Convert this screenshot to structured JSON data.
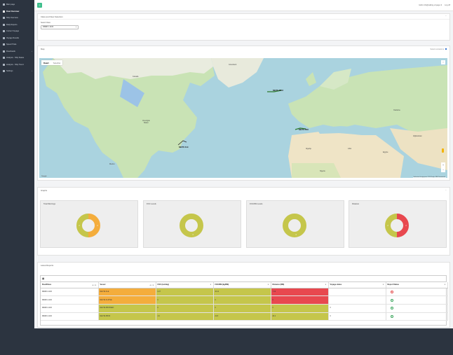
{
  "sidebar": {
    "items": [
      {
        "label": "Main page",
        "icon": "home-icon",
        "active": false
      },
      {
        "label": "Fleet Overview",
        "icon": "fleet-icon",
        "active": true
      },
      {
        "label": "Ship Overview",
        "icon": "ship-icon",
        "active": false
      },
      {
        "label": "Daily Reports",
        "icon": "report-icon",
        "active": false
      },
      {
        "label": "Current Voyage",
        "icon": "play-icon",
        "active": false
      },
      {
        "label": "Voyage Results",
        "icon": "results-icon",
        "active": false
      },
      {
        "label": "Speed Trials",
        "icon": "speed-icon",
        "active": false
      },
      {
        "label": "Downloads",
        "icon": "download-icon",
        "active": false,
        "has_children": true
      },
      {
        "label": "Analysis - Ship Status",
        "icon": "chart-icon",
        "active": false
      },
      {
        "label": "Analysis - Ship Trend",
        "icon": "trend-icon",
        "active": false
      },
      {
        "label": "Settings",
        "icon": "gear-icon",
        "active": false,
        "has_children": true
      }
    ]
  },
  "topbar": {
    "menu_icon": "hamburger-icon",
    "user": "Hello info@sailing-voyage.nl",
    "logout": "Log off"
  },
  "class_card": {
    "title": "Class and Fleet Selection",
    "select_label": "Select Class",
    "select_value": "DREB 1.1100"
  },
  "map_card": {
    "title": "Map",
    "toggle_label": "Select emissions",
    "tab_map": "Kaart",
    "tab_satellite": "Satelliet",
    "footer": "Sneltoetsen  Kaartgegevens ©2024 Google, INEGI  Voorwaarden",
    "google": "Google",
    "labels": {
      "canada": "Canada",
      "us": "Verenigde\nStaten",
      "mexico": "Mexico",
      "greenland": "Groenland",
      "algeria": "Algerije",
      "libya": "Libië",
      "egypt": "Egypte",
      "nigeria": "Nigeria",
      "afghanistan": "Afghanistan",
      "ukraine": "Oekraïne"
    },
    "vessels": [
      "NECTE CLE",
      "NECTE FRC2",
      "NECTE PRO"
    ]
  },
  "graphs_card": {
    "title": "Graphs",
    "charts": [
      {
        "title": "Total Warnings",
        "colors": [
          "#f4ad3c",
          "#c5c64b"
        ],
        "slices": [
          50,
          50
        ],
        "labels": [
          "2",
          "2"
        ]
      },
      {
        "title": "FOC Levels",
        "colors": [
          "#c5c64b"
        ],
        "slices": [
          100
        ],
        "labels": [
          "4"
        ]
      },
      {
        "title": "FOC/NM Levels",
        "colors": [
          "#c5c64b"
        ],
        "slices": [
          100
        ],
        "labels": [
          "4"
        ]
      },
      {
        "title": "Distance",
        "colors": [
          "#e8484f",
          "#c5c64b"
        ],
        "slices": [
          50,
          50
        ],
        "labels": [
          "2",
          "2"
        ]
      }
    ]
  },
  "reports_card": {
    "title": "Latest Reports",
    "tool_icon": "grid-icon",
    "columns": [
      "Fleet/Class",
      "Vessel",
      "FOC (ton/day)",
      "FOC/NM (kg/NM)",
      "Distance (NM)",
      "Voyage status",
      "Report Status"
    ],
    "rows": [
      {
        "fleet": "DREB 1.1100",
        "vessel": "NECTE CLE",
        "foc": "0.27",
        "focnm": "40.11",
        "distance": "7.19",
        "voyage": "",
        "status": "bad",
        "colors": [
          "",
          "orange",
          "olive",
          "olive",
          "red",
          "",
          ""
        ]
      },
      {
        "fleet": "DREB 1.1100",
        "vessel": "NECTE CLRTLE",
        "foc": "0",
        "focnm": "0",
        "distance": "0",
        "voyage": "",
        "status": "ok",
        "colors": [
          "",
          "orange",
          "olive",
          "olive",
          "red",
          "",
          ""
        ]
      },
      {
        "fleet": "DREB 1.1100",
        "vessel": "NECTE PROSSEO",
        "foc": "0",
        "focnm": "0",
        "distance": "0",
        "voyage": "0",
        "status": "ok",
        "colors": [
          "",
          "olive",
          "olive",
          "olive",
          "olive",
          "",
          ""
        ]
      },
      {
        "fleet": "DREB 1.1100",
        "vessel": "NECTE PRO3",
        "foc": "1.9",
        "focnm": "22.8",
        "distance": "20.2",
        "voyage": "0",
        "status": "ok",
        "colors": [
          "",
          "olive",
          "olive",
          "olive",
          "olive",
          "",
          ""
        ]
      }
    ]
  }
}
